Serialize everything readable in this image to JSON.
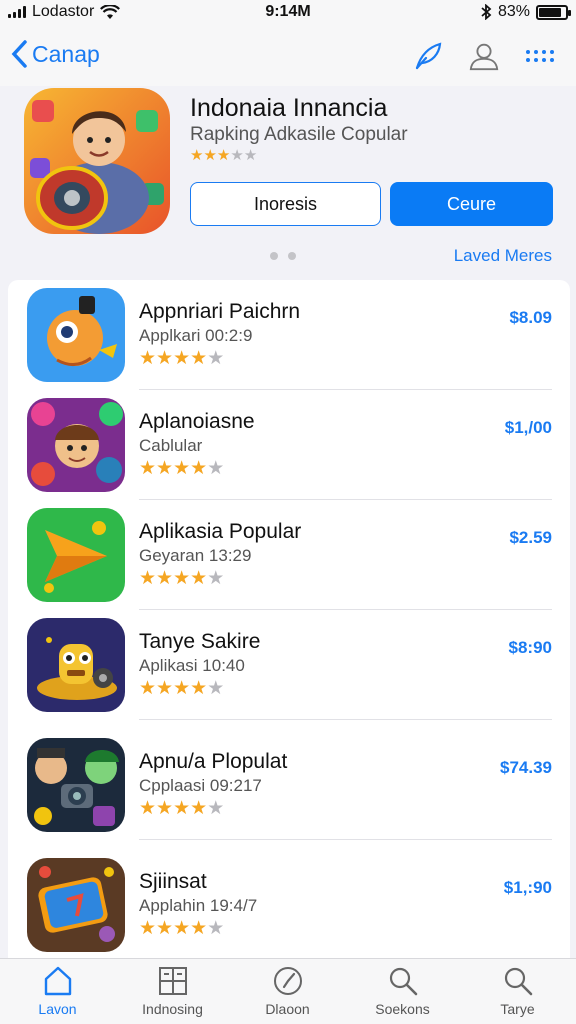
{
  "status_bar": {
    "carrier": "Lodastor",
    "time": "9:14M",
    "battery_percent": "83%",
    "battery_level": 0.83,
    "icons": [
      "signal-icon",
      "wifi-icon",
      "bluetooth-icon",
      "battery-icon"
    ]
  },
  "nav": {
    "back_label": "Canap",
    "icons": [
      "feather-icon",
      "person-icon",
      "grid-dots-icon"
    ]
  },
  "featured": {
    "title": "Indonaia Innancia",
    "subtitle": "Rapking Adkasile Copular",
    "rating": 3,
    "secondary_button": "Inoresis",
    "primary_button": "Ceure",
    "see_more": "Laved Meres",
    "page_count": 2
  },
  "apps": [
    {
      "title": "Appnriari Paichrn",
      "subtitle": "Applkari 00:2:9",
      "price": "$8.09",
      "rating": 4,
      "icon": "orange-character-icon"
    },
    {
      "title": "Aplanoiasne",
      "subtitle": "Cablular",
      "price": "$1,/00",
      "rating": 4,
      "icon": "game-collage-icon"
    },
    {
      "title": "Aplikasia Popular",
      "subtitle": "Geyaran 13:29",
      "price": "$2.59",
      "rating": 4,
      "icon": "play-arrow-icon"
    },
    {
      "title": "Tanye Sakire",
      "subtitle": "Aplikasi 10:40",
      "price": "$8:90",
      "rating": 4,
      "icon": "yellow-robot-icon"
    },
    {
      "title": "Apnu/a Plopulat",
      "subtitle": "Cpplaasi 09:217",
      "price": "$74.39",
      "rating": 4,
      "icon": "characters-camera-icon"
    },
    {
      "title": "Sjiinsat",
      "subtitle": "Applahin 19:4/7",
      "price": "$1,:90",
      "rating": 4,
      "icon": "blue-tablet-icon"
    }
  ],
  "tabs": [
    {
      "label": "Lavon",
      "icon": "home-icon",
      "active": true
    },
    {
      "label": "Indnosing",
      "icon": "grid-icon",
      "active": false
    },
    {
      "label": "Dlaoon",
      "icon": "compass-icon",
      "active": false
    },
    {
      "label": "Soekons",
      "icon": "search-icon",
      "active": false
    },
    {
      "label": "Tarye",
      "icon": "search-icon",
      "active": false
    }
  ],
  "colors": {
    "accent": "#1a7bf2",
    "star": "#f5a623",
    "star_off": "#b8b8bd"
  }
}
